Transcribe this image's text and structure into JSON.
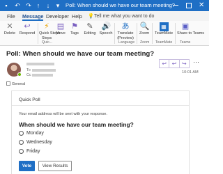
{
  "titlebar": {
    "title": "Poll: When should we have our team meeting? - Message (H...",
    "icons": [
      "save-icon",
      "undo-icon",
      "redo-icon",
      "up-icon",
      "down-icon",
      "customize-icon"
    ],
    "accent": "#1f6fc5"
  },
  "tabs": [
    {
      "label": "File"
    },
    {
      "label": "Message"
    },
    {
      "label": "Developer"
    },
    {
      "label": "Help"
    }
  ],
  "active_tab": "Message",
  "tell_me": "Tell me what you want to do",
  "ribbon": {
    "buttons": [
      {
        "label": "Delete",
        "icon": "delete-icon"
      },
      {
        "label": "Respond",
        "icon": "respond-icon"
      },
      {
        "label": "Quick Steps",
        "icon": "quick-steps-icon"
      },
      {
        "label": "Move",
        "icon": "move-icon"
      },
      {
        "label": "Tags",
        "icon": "tags-icon"
      },
      {
        "label": "Editing",
        "icon": "editing-icon"
      },
      {
        "label": "Speech",
        "icon": "speech-icon"
      },
      {
        "label": "Translate",
        "icon": "translate-icon"
      },
      {
        "label": "Zoom",
        "icon": "zoom-icon"
      },
      {
        "label": "TeamMate",
        "icon": "teammate-icon"
      },
      {
        "label": "Share to Teams",
        "icon": "teams-icon"
      }
    ],
    "quick_steps_sub": "Steps",
    "translate_sub": "(Preview)",
    "groups": [
      "Quic...",
      "Language",
      "Zoom",
      "TeamMate",
      "Teams"
    ]
  },
  "message": {
    "subject": "Poll: When should we have our team meeting?",
    "to_label": "To",
    "cc_label": "Cc",
    "time": "10:01 AM",
    "actions": [
      "reply-icon",
      "reply-all-icon",
      "forward-icon"
    ],
    "more": "···",
    "label": "General",
    "presence_color": "#6bb700"
  },
  "poll": {
    "card_title": "Quick Poll",
    "notice": "Your email address will be sent with your response.",
    "question": "When should we have our team meeting?",
    "options": [
      "Monday",
      "Wednesday",
      "Friday"
    ],
    "vote_label": "Vote",
    "view_results_label": "View Results"
  }
}
